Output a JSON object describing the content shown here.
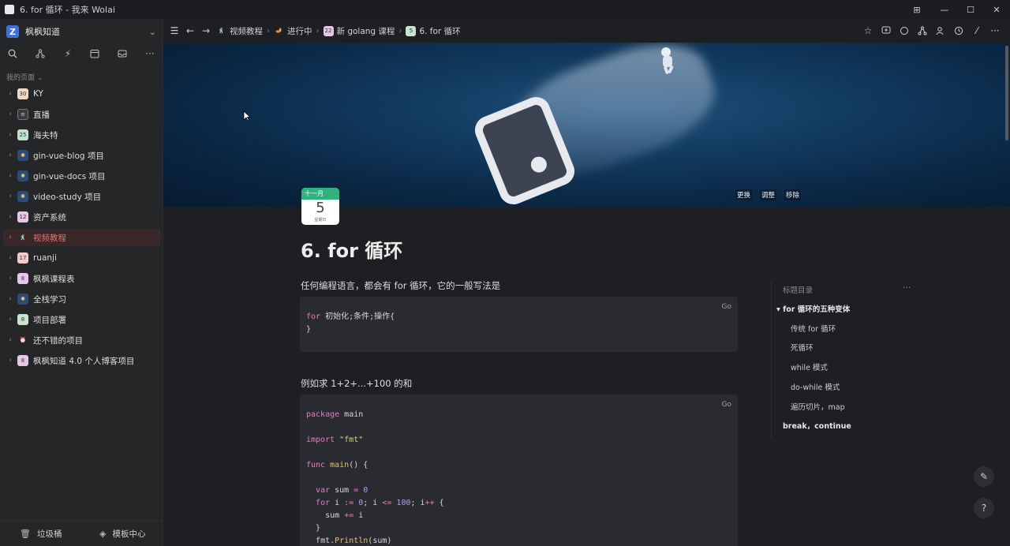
{
  "window": {
    "title": "6. for 循环 - 我来 Wolai",
    "controls": [
      "⊞",
      "—",
      "☐",
      "✕"
    ]
  },
  "sidebar": {
    "workspace": "枫枫知道",
    "section_label": "我的页面 ⌄",
    "items": [
      {
        "label": "KY",
        "icon": "calendar-icon",
        "icon_text": "30"
      },
      {
        "label": "直播",
        "icon": "document-icon",
        "icon_text": "≡"
      },
      {
        "label": "海夫特",
        "icon": "calendar-icon",
        "icon_text": "25"
      },
      {
        "label": "gin-vue-blog 项目",
        "icon": "sparkle-icon",
        "icon_text": "✺"
      },
      {
        "label": "gin-vue-docs 项目",
        "icon": "sparkle-icon",
        "icon_text": "✺"
      },
      {
        "label": "video-study 项目",
        "icon": "sparkle-icon",
        "icon_text": "✺"
      },
      {
        "label": "资产系统",
        "icon": "calendar-icon",
        "icon_text": "12"
      },
      {
        "label": "视频教程",
        "icon": "figure-icon",
        "icon_text": "🕺"
      },
      {
        "label": "ruanji",
        "icon": "calendar-icon",
        "icon_text": "17"
      },
      {
        "label": "枫枫课程表",
        "icon": "calendar-icon",
        "icon_text": "8"
      },
      {
        "label": "全栈学习",
        "icon": "sparkle-icon",
        "icon_text": "✺"
      },
      {
        "label": "项目部署",
        "icon": "calendar-icon",
        "icon_text": "8"
      },
      {
        "label": "还不错的项目",
        "icon": "alarm-icon",
        "icon_text": "⏰"
      },
      {
        "label": "枫枫知道 4.0 个人博客项目",
        "icon": "calendar-icon",
        "icon_text": "8"
      }
    ],
    "active_index": 7,
    "trash_label": "垃圾桶",
    "templates_label": "模板中心"
  },
  "breadcrumbs": [
    {
      "label": "视频教程",
      "icon_text": "🕺"
    },
    {
      "label": "进行中",
      "icon_text": "🪔"
    },
    {
      "label": "新 golang 课程",
      "icon_text": "22"
    },
    {
      "label": "6. for 循环",
      "icon_text": "5"
    }
  ],
  "cover": {
    "actions": [
      "更换",
      "调整",
      "移除"
    ]
  },
  "page": {
    "icon_month": "十一月",
    "icon_day": "5",
    "icon_weekday": "星期日",
    "title": "6. for 循环",
    "intro": "任何编程语言，都会有 for 循环，它的一般写法是",
    "example_intro": "例如求 1+2+...+100 的和",
    "code1_lang": "Go",
    "code2_lang": "Go",
    "code1": {
      "line1_kw": "for",
      "line1_rest": " 初始化;条件;操作{",
      "line2": "}"
    },
    "code2": {
      "package_kw": "package",
      "package_name": " main",
      "import_kw": "import",
      "import_str": " \"fmt\"",
      "func_kw": "func",
      "func_name": " main",
      "func_rest": "() {",
      "var_kw": "var",
      "var_name": " sum ",
      "var_op": "=",
      "var_val": " 0",
      "for_kw": "for",
      "for_i": " i ",
      "for_op1": ":=",
      "for_n1": " 0",
      "for_mid": "; i ",
      "for_op2": "<=",
      "for_n2": " 100",
      "for_tail": "; i",
      "for_op3": "++",
      "for_brace": " {",
      "sum_name": "sum ",
      "sum_op": "+=",
      "sum_rhs": " i",
      "close_inner": "}",
      "println_pkg": "fmt.",
      "println_fn": "Println",
      "println_arg": "(sum)"
    }
  },
  "toc": {
    "heading": "标题目录",
    "more": "···",
    "items": [
      "▾ for 循环的五种变体",
      "传统 for 循环",
      "死循环",
      "while 模式",
      "do-while 模式",
      "遍历切片，map",
      "break，continue"
    ]
  }
}
